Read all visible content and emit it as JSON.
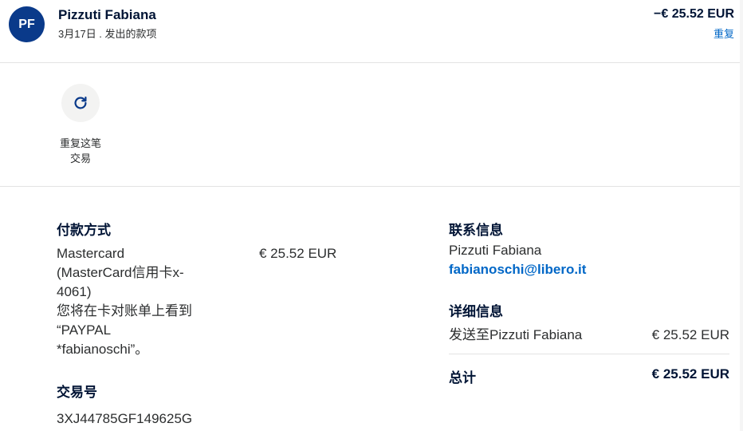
{
  "header": {
    "avatar_initials": "PF",
    "merchant_name": "Pizzuti Fabiana",
    "subtitle": "3月17日 . 发出的款项",
    "amount": "−€ 25.52 EUR",
    "status_link": "重复"
  },
  "actions": {
    "repeat_icon": "refresh-icon",
    "repeat_label_line1": "重复这笔",
    "repeat_label_line2": "交易"
  },
  "payment": {
    "title": "付款方式",
    "lines": [
      "Mastercard",
      "(MasterCard信用卡x-",
      "4061)",
      "您将在卡对账单上看到",
      "“PAYPAL",
      "*fabianoschi”。"
    ],
    "amount": "€ 25.52 EUR"
  },
  "transaction": {
    "title": "交易号",
    "id": "3XJ44785GF149625G"
  },
  "contact": {
    "title": "联系信息",
    "name": "Pizzuti Fabiana",
    "email": "fabianoschi@libero.it"
  },
  "details": {
    "title": "详细信息",
    "sent_to_label": "发送至Pizzuti Fabiana",
    "sent_to_amount": "€ 25.52 EUR",
    "total_label": "总计",
    "total_amount": "€ 25.52 EUR"
  },
  "colors": {
    "brand_navy": "#0a3a8a",
    "link_blue": "#0067c7"
  }
}
